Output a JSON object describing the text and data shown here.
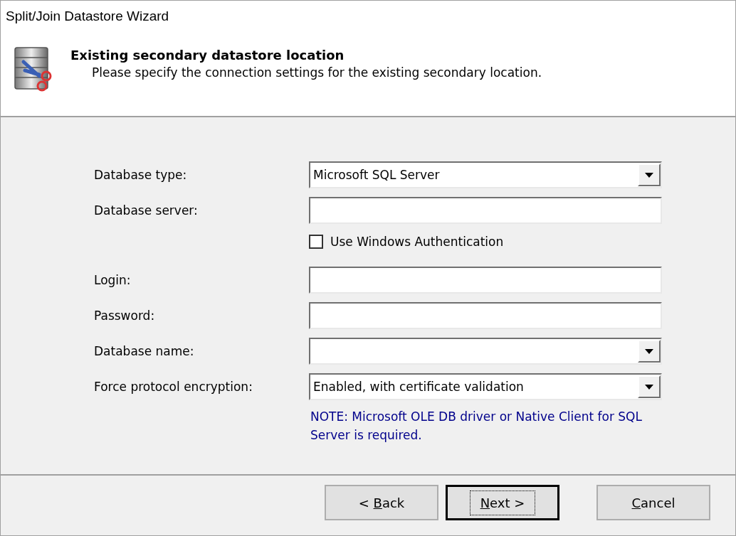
{
  "window": {
    "title": "Split/Join Datastore Wizard"
  },
  "header": {
    "title": "Existing secondary datastore location",
    "subtitle": "Please specify the connection settings for the existing secondary location."
  },
  "fields": [
    {
      "kind": "dropdown",
      "label": "Database type:",
      "value": "Microsoft SQL Server"
    },
    {
      "kind": "text",
      "label": "Database server:"
    },
    {
      "kind": "checkbox",
      "label": "Use Windows Authentication",
      "checked": false
    },
    {
      "kind": "text",
      "label": "Login:"
    },
    {
      "kind": "text",
      "label": "Password:"
    },
    {
      "kind": "dropdown",
      "label": "Database name:"
    },
    {
      "kind": "dropdown",
      "label": "Force protocol encryption:",
      "value": "Enabled, with certificate validation"
    }
  ],
  "note": "NOTE: Microsoft OLE DB driver or Native Client for SQL Server is required.",
  "buttons": [
    {
      "before": "< ",
      "key": "B",
      "after": "ack",
      "focused": false
    },
    {
      "key": "N",
      "after": "ext >",
      "focused": true
    },
    {
      "key": "C",
      "after": "ancel",
      "focused": false
    }
  ]
}
